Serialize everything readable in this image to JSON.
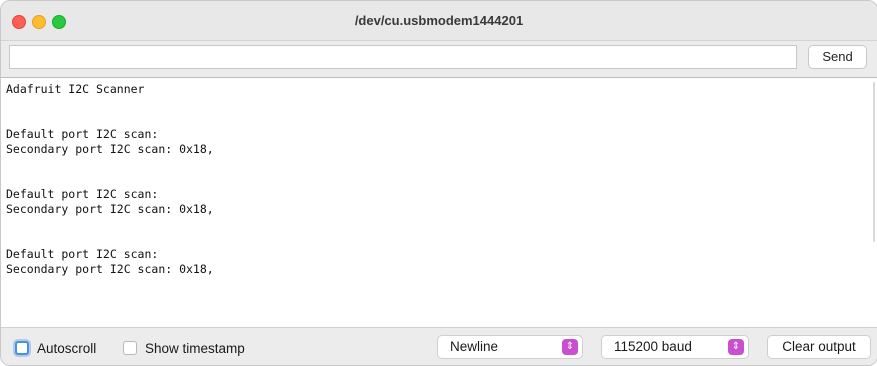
{
  "window": {
    "title": "/dev/cu.usbmodem1444201"
  },
  "input": {
    "value": "",
    "send_label": "Send"
  },
  "output": {
    "lines": [
      "Adafruit I2C Scanner",
      "",
      "",
      "Default port I2C scan:",
      "Secondary port I2C scan: 0x18,",
      "",
      "",
      "Default port I2C scan:",
      "Secondary port I2C scan: 0x18,",
      "",
      "",
      "Default port I2C scan:",
      "Secondary port I2C scan: 0x18,"
    ]
  },
  "footer": {
    "autoscroll_label": "Autoscroll",
    "timestamp_label": "Show timestamp",
    "line_ending": "Newline",
    "baud": "115200 baud",
    "clear_label": "Clear output"
  },
  "colors": {
    "close": "#ff5f57",
    "minimize": "#febc2e",
    "zoom": "#28c840",
    "select_accent": "#c84fd0",
    "focus_ring": "#4a90e2"
  },
  "icons": {
    "select_chevron": "chevron-up-down-icon"
  }
}
